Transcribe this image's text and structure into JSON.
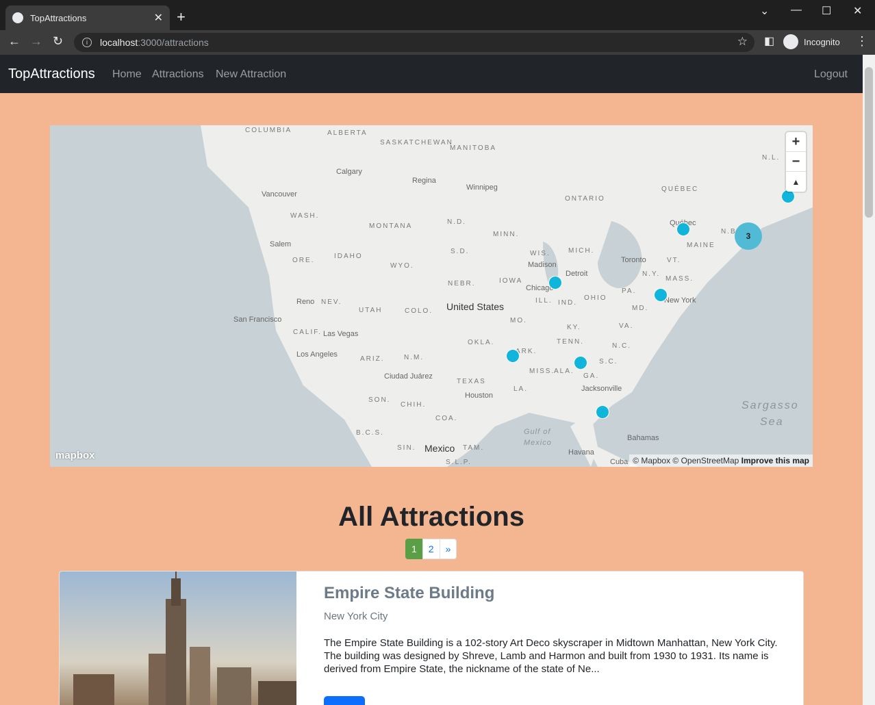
{
  "browser": {
    "tab_title": "TopAttractions",
    "url_host": "localhost",
    "url_path": ":3000/attractions",
    "profile_label": "Incognito"
  },
  "nav": {
    "brand": "TopAttractions",
    "links": [
      "Home",
      "Attractions",
      "New Attraction"
    ],
    "logout": "Logout"
  },
  "map": {
    "labels": {
      "columbia": "COLUMBIA",
      "alberta": "ALBERTA",
      "saskatchewan": "SASKATCHEWAN",
      "manitoba": "MANITOBA",
      "calgary": "Calgary",
      "regina": "Regina",
      "winnipeg": "Winnipeg",
      "vancouver": "Vancouver",
      "ontario": "ONTARIO",
      "quebec_prov": "QUÉBEC",
      "nl": "N.L.",
      "wash": "WASH.",
      "montana": "MONTANA",
      "nd": "N.D.",
      "minn": "MINN.",
      "quebec": "Québec",
      "nb": "N.B.",
      "salem": "Salem",
      "ore": "ORE.",
      "idaho": "IDAHO",
      "wyo": "WYO.",
      "sd": "S.D.",
      "wis": "WIS.",
      "mich": "MICH.",
      "maine": "MAINE",
      "madison": "Madison",
      "toronto": "Toronto",
      "vt": "VT.",
      "detroit": "Detroit",
      "ny": "N.Y.",
      "mass": "MASS.",
      "nebr": "NEBR.",
      "iowa": "IOWA",
      "chicago": "Chicago",
      "pa": "PA.",
      "reno": "Reno",
      "nev": "NEV.",
      "utah": "UTAH",
      "colo": "COLO.",
      "us": "United States",
      "ill": "ILL.",
      "ind": "IND.",
      "ohio": "OHIO",
      "newyork": "New York",
      "md": "MD.",
      "sanfran": "San Francisco",
      "mo": "MO.",
      "va": "VA.",
      "calif": "CALIF.",
      "lasvegas": "Las Vegas",
      "ky": "KY.",
      "okla": "OKLA.",
      "tenn": "TENN.",
      "nc": "N.C.",
      "losangeles": "Los Angeles",
      "ariz": "ARIZ.",
      "nm": "N.M.",
      "ark": "ARK.",
      "sc": "S.C.",
      "ciudad": "Ciudad Juárez",
      "texas": "TEXAS",
      "miss": "MISS.",
      "ala": "ALA.",
      "ga": "GA.",
      "jacksonville": "Jacksonville",
      "houston": "Houston",
      "la": "LA.",
      "son": "SON.",
      "chih": "CHIH.",
      "sargasso": "Sargasso",
      "sea": "Sea",
      "coa": "COA.",
      "gulf": "Gulf of",
      "mexico_water": "Mexico",
      "bcs": "B.C.S.",
      "sin": "SIN.",
      "mexico": "Mexico",
      "tam": "TAM.",
      "bahamas": "Bahamas",
      "havana": "Havana",
      "slp": "S.L.P.",
      "cuba": "Cuba"
    },
    "cluster_count": "3",
    "logo": "mapbox",
    "attribution": "© Mapbox © OpenStreetMap",
    "improve": "Improve this map",
    "cluster_color": "#11b4da"
  },
  "main": {
    "heading": "All Attractions",
    "pages": [
      "1",
      "2",
      "»"
    ]
  },
  "card": {
    "title": "Empire State Building",
    "location": "New York City",
    "description": "The Empire State Building is a 102-story Art Deco skyscraper in Midtown Manhattan, New York City. The building was designed by Shreve, Lamb and Harmon and built from 1930 to 1931. Its name is derived from Empire State, the nickname of the state of Ne..."
  },
  "colors": {
    "page_bg": "#f4b690",
    "navbar_bg": "#212529",
    "active_page": "#5a9e46",
    "button": "#0d6efd"
  }
}
